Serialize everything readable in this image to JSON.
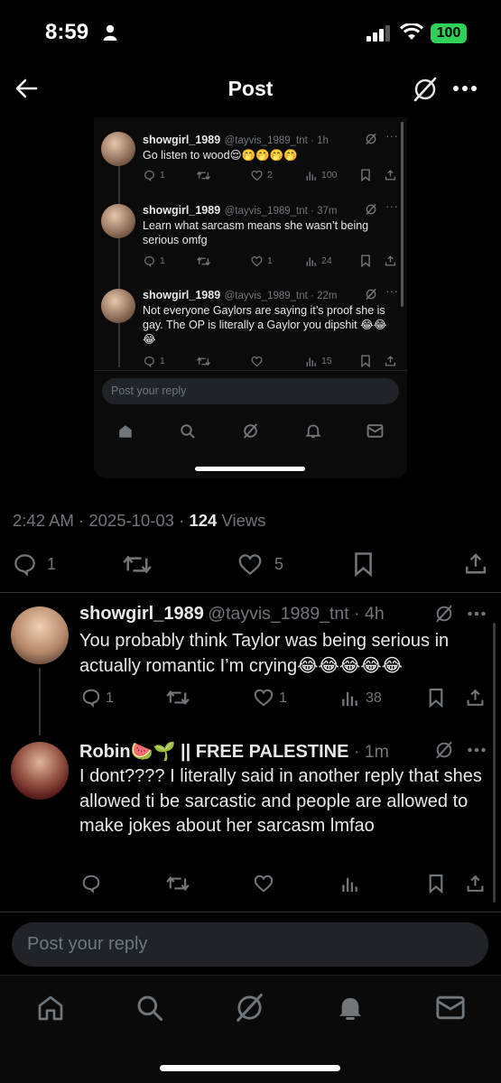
{
  "status_bar": {
    "time": "8:59",
    "battery": "100"
  },
  "header": {
    "title": "Post"
  },
  "embed": {
    "replies": [
      {
        "name": "showgirl_1989",
        "handle": "@tayvis_1989_tnt",
        "time": "1h",
        "text": "Go listen to wood😌🤭🤭🤭🤭",
        "replies": "1",
        "reposts": "",
        "likes": "2",
        "views": "100"
      },
      {
        "name": "showgirl_1989",
        "handle": "@tayvis_1989_tnt",
        "time": "37m",
        "text": "Learn what sarcasm means she wasn’t being serious omfg",
        "replies": "1",
        "reposts": "",
        "likes": "1",
        "views": "24"
      },
      {
        "name": "showgirl_1989",
        "handle": "@tayvis_1989_tnt",
        "time": "22m",
        "text": "Not everyone Gaylors are saying it’s proof she is gay. The OP is literally a Gaylor you dipshit 😂😂😂",
        "replies": "1",
        "reposts": "",
        "likes": "",
        "views": "15"
      }
    ],
    "reply_placeholder": "Post your reply"
  },
  "post_meta": {
    "time": "2:42 AM",
    "date": "2025-10-03",
    "views_count": "124",
    "views_label": "Views"
  },
  "post_actions": {
    "replies": "1",
    "likes": "5"
  },
  "replies": [
    {
      "name": "showgirl_1989",
      "handle": "@tayvis_1989_tnt",
      "time": "4h",
      "text": "You probably think Taylor was being serious in actually romantic I’m crying😂😂😂😂😂",
      "replies": "1",
      "likes": "1",
      "views": "38"
    },
    {
      "name": "Robin🍉🌱 || FREE PALESTINE",
      "time": "1m",
      "text": "I dont???? I literally said in another reply that shes allowed ti be sarcastic and people are allowed to make jokes about her sarcasm lmfao"
    }
  ],
  "reply_bar": {
    "placeholder": "Post your reply"
  },
  "icons": [
    "back-arrow-icon",
    "grok-icon",
    "more-icon",
    "reply-icon",
    "repost-icon",
    "like-icon",
    "views-icon",
    "bookmark-icon",
    "share-icon",
    "home-icon",
    "search-icon",
    "notifications-icon",
    "messages-icon"
  ]
}
